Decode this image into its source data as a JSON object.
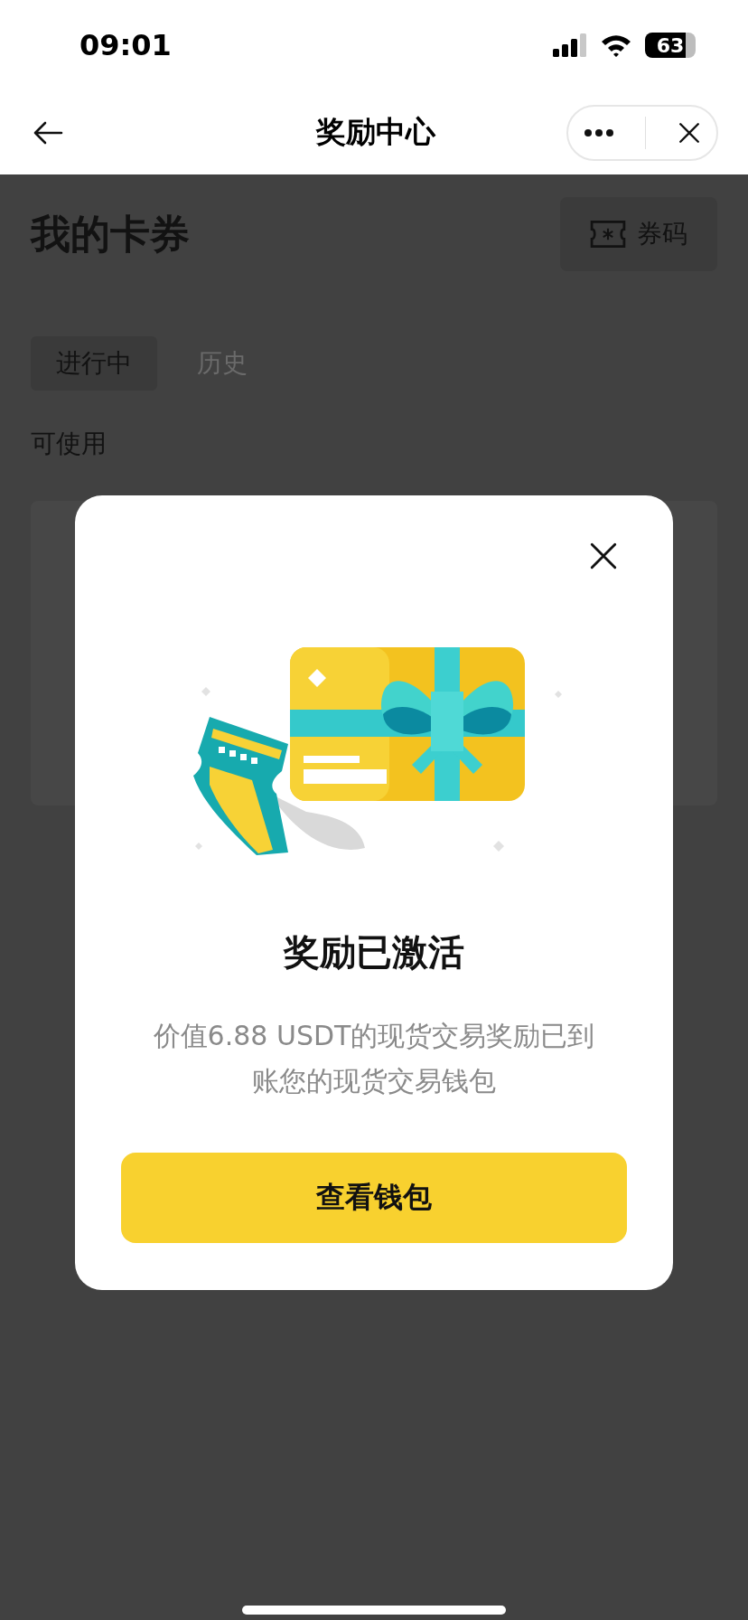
{
  "status_bar": {
    "time": "09:01",
    "battery": "63"
  },
  "nav": {
    "title": "奖励中心"
  },
  "page": {
    "title": "我的卡券",
    "code_button": "券码",
    "tabs": [
      {
        "label": "进行中",
        "selected": true
      },
      {
        "label": "历史",
        "selected": false
      }
    ],
    "section": "可使用"
  },
  "dialog": {
    "title": "奖励已激活",
    "message": "价值6.88 USDT的现货交易奖励已到账您的现货交易钱包",
    "button": "查看钱包"
  }
}
